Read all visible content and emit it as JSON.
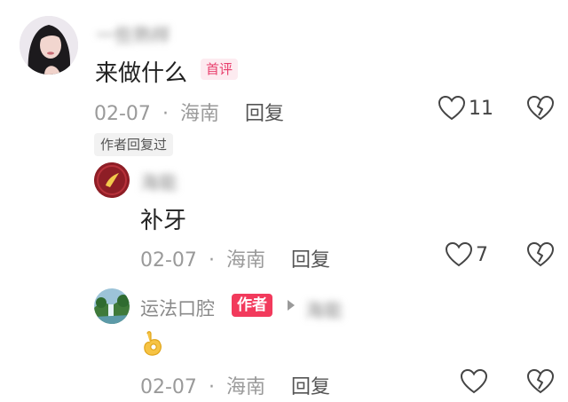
{
  "comments": [
    {
      "username": "一些熟样",
      "text": "来做什么",
      "badge": "首评",
      "date": "02-07",
      "separator": "·",
      "location": "海南",
      "reply_label": "回复",
      "like_count": "11",
      "author_replied_tag": "作者回复过",
      "icons": [
        "heart-outline-icon",
        "broken-heart-icon"
      ]
    },
    {
      "username": "海能",
      "text": "补牙",
      "date": "02-07",
      "separator": "·",
      "location": "海南",
      "reply_label": "回复",
      "like_count": "7",
      "icons": [
        "heart-outline-icon",
        "broken-heart-icon"
      ]
    },
    {
      "username": "运法口腔",
      "author_badge": "作者",
      "reply_to": "海能",
      "text": "👌",
      "date": "02-07",
      "separator": "·",
      "location": "海南",
      "reply_label": "回复",
      "like_count": "",
      "icons": [
        "heart-outline-icon",
        "broken-heart-icon",
        "caret-right-icon",
        "ok-hand-icon"
      ]
    }
  ],
  "colors": {
    "accent_pink": "#e83e6c",
    "author_badge_bg": "#f23a5c",
    "meta_gray": "#9a9a9a"
  }
}
